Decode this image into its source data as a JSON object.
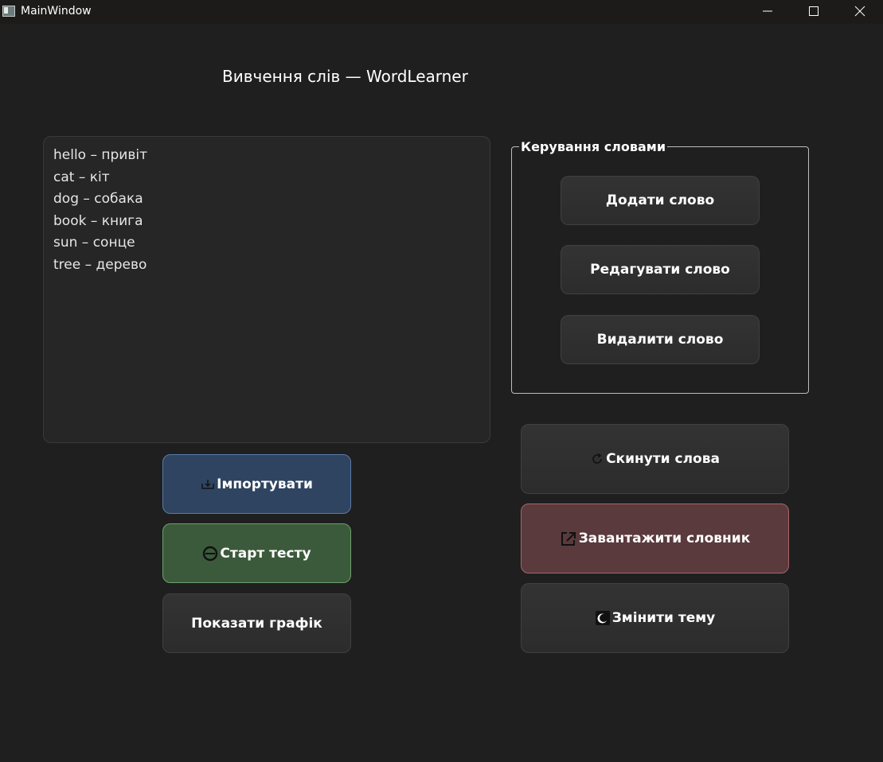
{
  "window": {
    "title": "MainWindow"
  },
  "header": {
    "title": "Вивчення слів — WordLearner"
  },
  "word_list": {
    "lines": [
      "hello – привіт",
      "cat – кіт",
      "dog – собака",
      "book – книга",
      "sun – сонце",
      "tree – дерево"
    ]
  },
  "management": {
    "title": "Керування словами",
    "add_label": "Додати слово",
    "edit_label": "Редагувати слово",
    "delete_label": "Видалити слово"
  },
  "actions": {
    "import_label": "Імпортувати",
    "start_test_label": "Старт тесту",
    "show_chart_label": "Показати графік",
    "reset_label": "Скинути слова",
    "download_label": "Завантажити словник",
    "theme_label": "Змінити тему"
  },
  "icons": {
    "import": "import-icon",
    "start_test": "start-test-icon",
    "reset": "refresh-icon",
    "download": "export-icon",
    "theme": "moon-icon"
  },
  "colors": {
    "background": "#1f1f1f",
    "import_button": "#2f4460",
    "start_button": "#3b5a3b",
    "download_button": "#5a3a3d"
  }
}
